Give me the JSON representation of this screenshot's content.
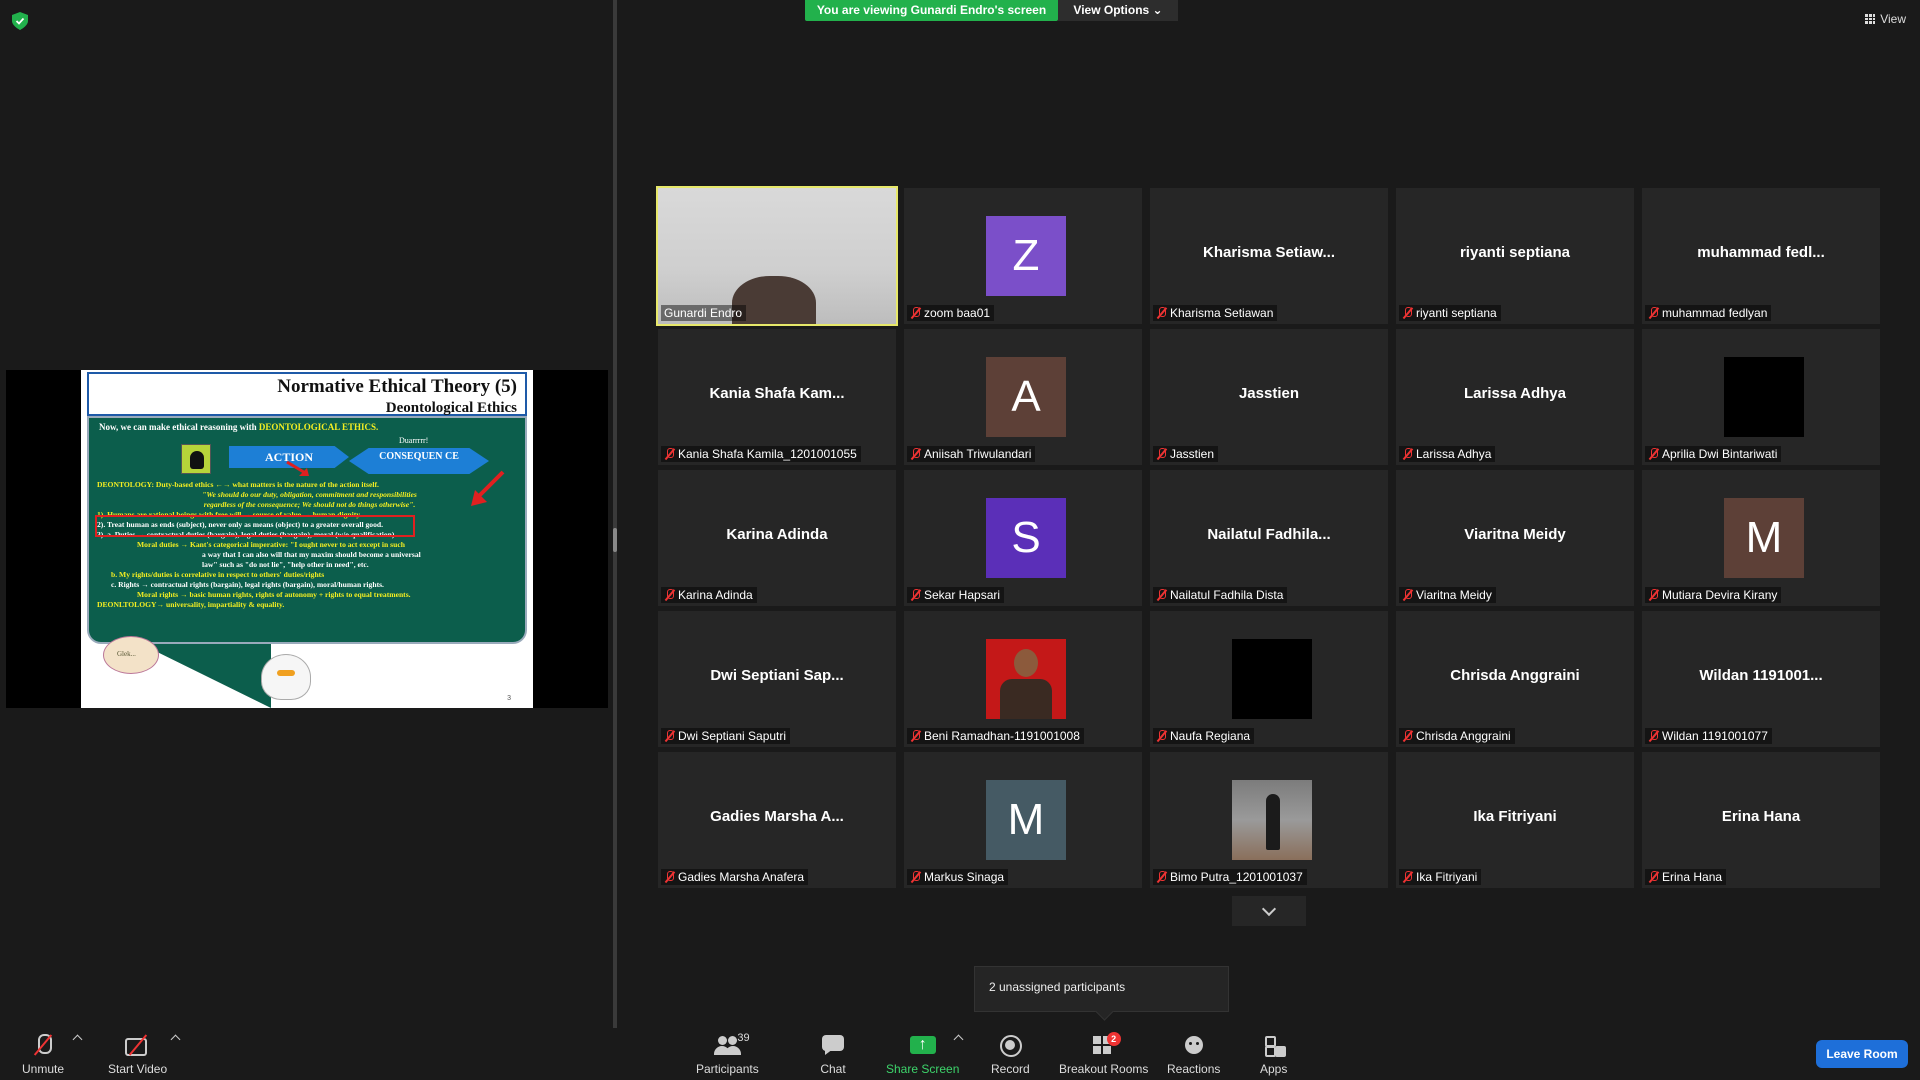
{
  "banner": {
    "viewing_text": "You are viewing Gunardi Endro's screen",
    "view_options": "View Options"
  },
  "top_right": {
    "view_label": "View"
  },
  "slide": {
    "title": "Normative Ethical Theory (5)",
    "subtitle": "Deontological Ethics",
    "intro_prefix": "Now, we can make ethical reasoning with ",
    "intro_highlight": "DEONTOLOGICAL ETHICS.",
    "action_label": "ACTION",
    "duarr": "Duarrrrr!",
    "conseq_label": "CONSEQUEN CE",
    "lines": [
      "DEONTOLOGY: Duty-based ethics ←→ what matters is the nature of the action itself.",
      "\"We should do our duty, obligation, commitment and responsibilities",
      "regardless of the consequence; We should not do things otherwise\".",
      "1). Humans are rational beings with free will → source of value → human dignity.",
      "2). Treat human as ends (subject), never only as means (object) to a greater overall good.",
      "3). a. Duties → contractual duties (bargain), legal duties (bargain), moral (w/o qualification)",
      "Moral duties → Kant's categorical imperative: \"I ought never to act except in such",
      "a way that I can also will that my maxim should become a universal",
      "law\" such as \"do not lie\", \"help other in need\", etc.",
      "b. My rights/duties is correlative in respect to others' duties/rights",
      "c. Rights → contractual rights (bargain), legal rights (bargain), moral/human rights.",
      "Moral rights → basic human rights, rights of autonomy + rights to equal treatments.",
      "DEONLTOLOGY→ universality, impartiality & equality."
    ],
    "cloud_text": "Glek...",
    "page_number": "3"
  },
  "participants": [
    {
      "big": "",
      "name": "Gunardi Endro",
      "kind": "video",
      "active": true,
      "muted": false
    },
    {
      "big": "",
      "name": "zoom baa01",
      "kind": "avatar",
      "letter": "Z",
      "color": "#7b4fc9",
      "muted": true
    },
    {
      "big": "Kharisma  Setiaw...",
      "name": "Kharisma Setiawan",
      "kind": "text",
      "muted": true
    },
    {
      "big": "riyanti septiana",
      "name": "riyanti septiana",
      "kind": "text",
      "muted": true
    },
    {
      "big": "muhammad  fedl...",
      "name": "muhammad fedlyan",
      "kind": "text",
      "muted": true
    },
    {
      "big": "Kania  Shafa  Kam...",
      "name": "Kania Shafa Kamila_1201001055",
      "kind": "text",
      "muted": true
    },
    {
      "big": "",
      "name": "Aniisah Triwulandari",
      "kind": "avatar",
      "letter": "A",
      "color": "#5d4037",
      "muted": true
    },
    {
      "big": "Jasstien",
      "name": "Jasstien",
      "kind": "text",
      "muted": true
    },
    {
      "big": "Larissa Adhya",
      "name": "Larissa Adhya",
      "kind": "text",
      "muted": true
    },
    {
      "big": "",
      "name": "Aprilia Dwi Bintariwati",
      "kind": "black",
      "muted": true
    },
    {
      "big": "Karina Adinda",
      "name": "Karina Adinda",
      "kind": "text",
      "muted": true
    },
    {
      "big": "",
      "name": "Sekar Hapsari",
      "kind": "avatar",
      "letter": "S",
      "color": "#5b2fb8",
      "muted": true
    },
    {
      "big": "Nailatul  Fadhila...",
      "name": "Nailatul Fadhila Dista",
      "kind": "text",
      "muted": true
    },
    {
      "big": "Viaritna Meidy",
      "name": "Viaritna Meidy",
      "kind": "text",
      "muted": true
    },
    {
      "big": "",
      "name": "Mutiara Devira Kirany",
      "kind": "avatar",
      "letter": "M",
      "color": "#5d4037",
      "muted": true
    },
    {
      "big": "Dwi  Septiani  Sap...",
      "name": "Dwi Septiani Saputri",
      "kind": "text",
      "muted": true
    },
    {
      "big": "",
      "name": "Beni Ramadhan-1191001008",
      "kind": "photo-red",
      "muted": true
    },
    {
      "big": "",
      "name": "Naufa Regiana",
      "kind": "black",
      "muted": true
    },
    {
      "big": "Chrisda Anggraini",
      "name": "Chrisda Anggraini",
      "kind": "text",
      "muted": true
    },
    {
      "big": "Wildan  1191001...",
      "name": "Wildan 1191001077",
      "kind": "text",
      "muted": true
    },
    {
      "big": "Gadies  Marsha  A...",
      "name": "Gadies Marsha Anafera",
      "kind": "text",
      "muted": true
    },
    {
      "big": "",
      "name": "Markus Sinaga",
      "kind": "avatar",
      "letter": "M",
      "color": "#455a64",
      "muted": true
    },
    {
      "big": "",
      "name": "Bimo Putra_1201001037",
      "kind": "photo-street",
      "muted": true
    },
    {
      "big": "Ika Fitriyani",
      "name": "Ika Fitriyani",
      "kind": "text",
      "muted": true
    },
    {
      "big": "Erina Hana",
      "name": "Erina Hana",
      "kind": "text",
      "muted": true
    }
  ],
  "unassigned": "2 unassigned participants",
  "toolbar": {
    "unmute": "Unmute",
    "start_video": "Start Video",
    "participants": "Participants",
    "participants_count": "39",
    "chat": "Chat",
    "share_screen": "Share Screen",
    "record": "Record",
    "breakout_rooms": "Breakout Rooms",
    "breakout_badge": "2",
    "reactions": "Reactions",
    "apps": "Apps",
    "leave_room": "Leave Room"
  }
}
